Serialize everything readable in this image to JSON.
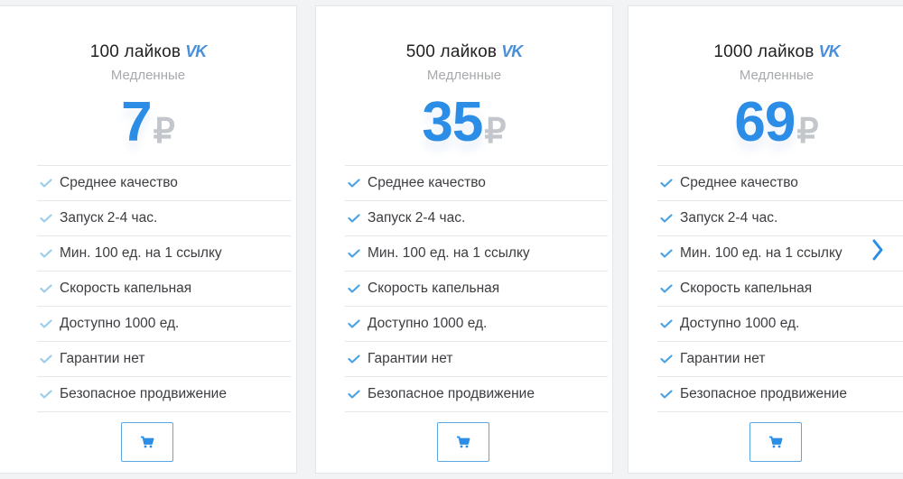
{
  "currency_symbol": "₽",
  "vk_logo_text": "VK",
  "accent_color": "#2b8de6",
  "cards": [
    {
      "title": "100 лайков",
      "subtitle": "Медленные",
      "price": "7",
      "features": [
        "Среднее качество",
        "Запуск 2-4 час.",
        "Мин. 100 ед. на 1 ссылку",
        "Скорость капельная",
        "Доступно 1000 ед.",
        "Гарантии нет",
        "Безопасное продвижение"
      ]
    },
    {
      "title": "500 лайков",
      "subtitle": "Медленные",
      "price": "35",
      "features": [
        "Среднее качество",
        "Запуск 2-4 час.",
        "Мин. 100 ед. на 1 ссылку",
        "Скорость капельная",
        "Доступно 1000 ед.",
        "Гарантии нет",
        "Безопасное продвижение"
      ]
    },
    {
      "title": "1000 лайков",
      "subtitle": "Медленные",
      "price": "69",
      "features": [
        "Среднее качество",
        "Запуск 2-4 час.",
        "Мин. 100 ед. на 1 ссылку",
        "Скорость капельная",
        "Доступно 1000 ед.",
        "Гарантии нет",
        "Безопасное продвижение"
      ]
    }
  ]
}
